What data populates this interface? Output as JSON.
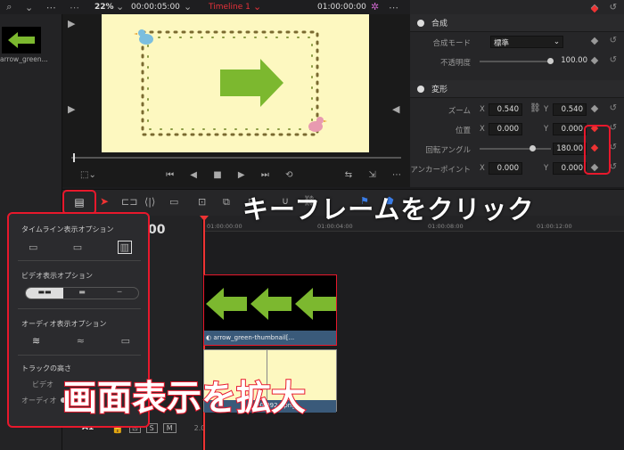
{
  "viewer": {
    "zoom": "22%",
    "timecode_left": "00:00:05:00",
    "timeline_name": "Timeline 1",
    "timecode_right": "01:00:00:00"
  },
  "left_panel": {
    "thumb_label": "arrow_green..."
  },
  "inspector": {
    "composite": {
      "title": "合成",
      "mode_label": "合成モード",
      "mode_value": "標準",
      "opacity_label": "不透明度",
      "opacity_value": "100.00"
    },
    "transform": {
      "title": "変形",
      "zoom_label": "ズーム",
      "zoom_x": "0.540",
      "zoom_y": "0.540",
      "position_label": "位置",
      "pos_x": "0.000",
      "pos_y": "0.000",
      "rotation_label": "回転アングル",
      "rotation_value": "180.00",
      "anchor_label": "アンカーポイント",
      "anchor_x": "0.000",
      "anchor_y": "0.000"
    }
  },
  "timeline": {
    "ruler_labels": [
      "01:00:00:00",
      "01:00:04:00",
      "01:00:08:00",
      "01:00:12:00"
    ],
    "header_time": "00",
    "video_clip_label": "arrow_green-thumbnail[...",
    "audio_clip_label": "-0 092...png",
    "audio_track": "A1",
    "audio_level": "2.0",
    "track_buttons": [
      "S",
      "M"
    ]
  },
  "popup": {
    "timeline_options": "タイムライン表示オプション",
    "video_options": "ビデオ表示オプション",
    "audio_options": "オーディオ表示オプション",
    "track_height": "トラックの高さ",
    "video_label": "ビデオ",
    "audio_label": "オーディオ"
  },
  "annotations": {
    "keyframe_callout": "キーフレームをクリック",
    "zoom_callout": "画面表示を拡大"
  },
  "colors": {
    "accent": "#e8182c",
    "arrow_green": "#7cb82f",
    "canvas": "#fdf8c0"
  }
}
